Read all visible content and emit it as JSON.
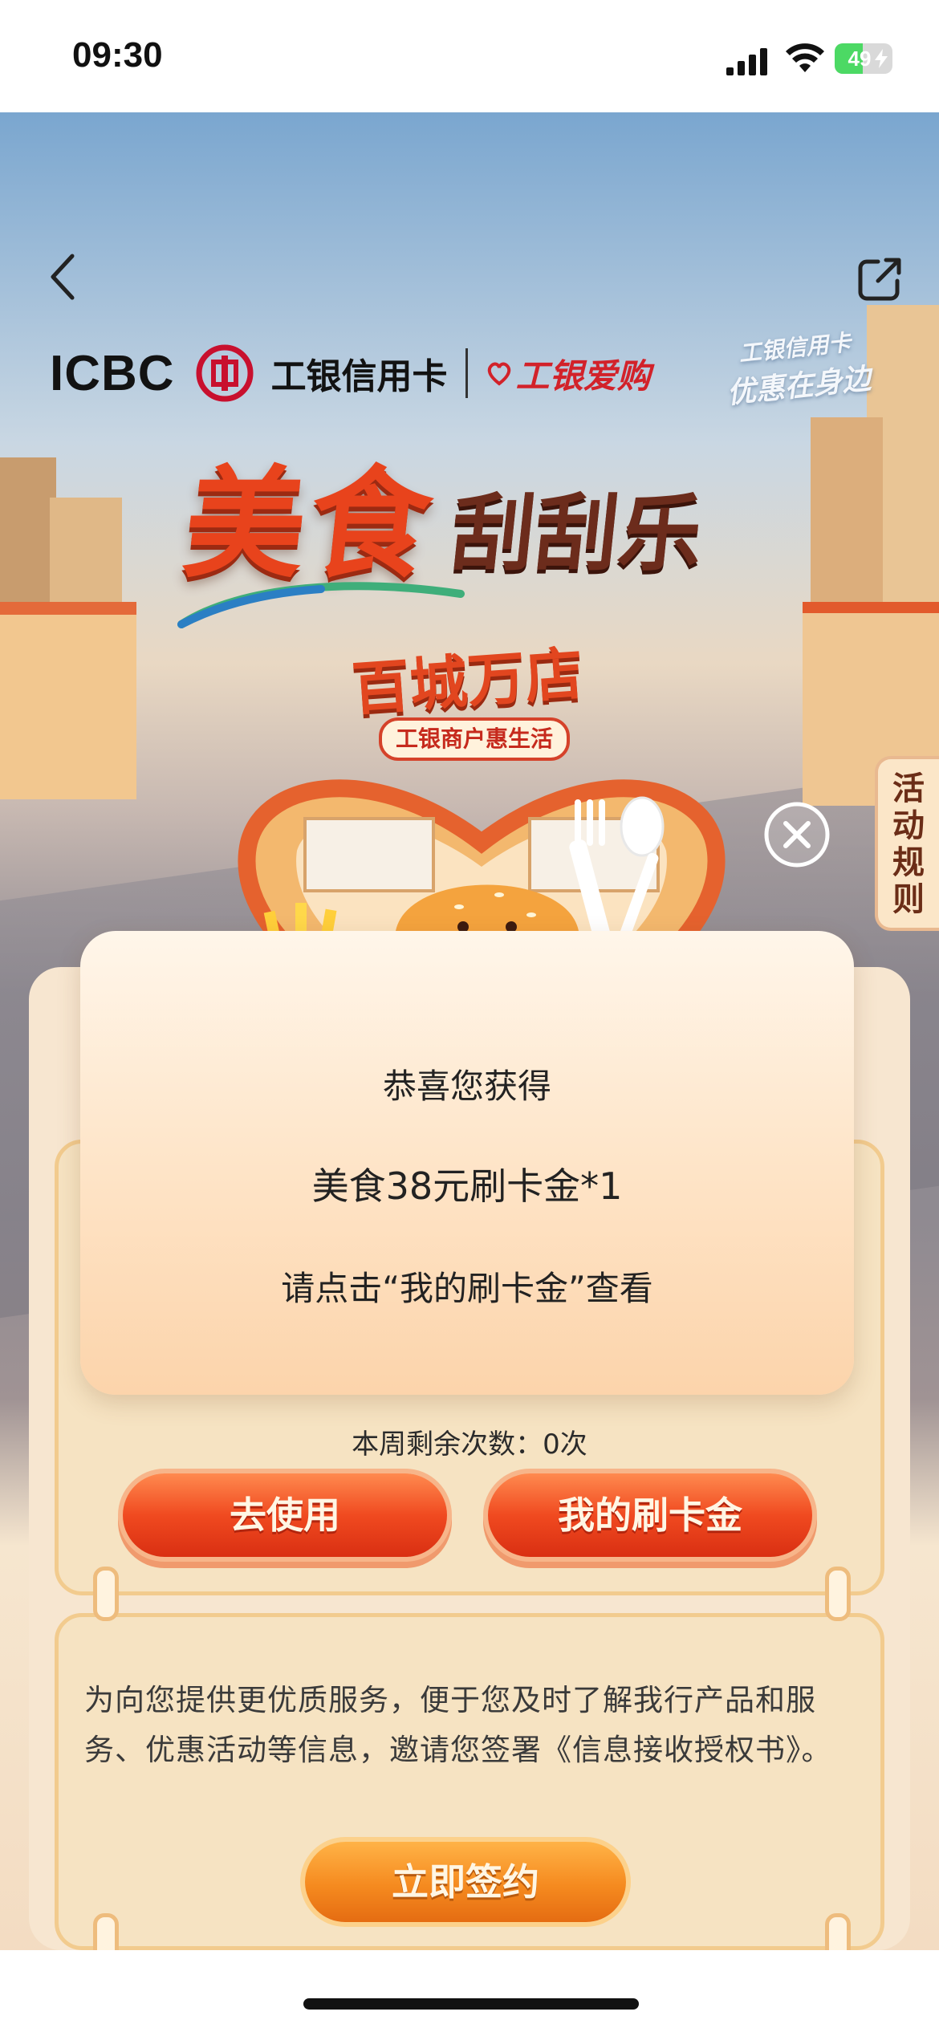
{
  "status_bar": {
    "time": "09:30",
    "battery": "49",
    "battery_level": 0.49
  },
  "header": {
    "brand": "ICBC",
    "card_name": "工银信用卡",
    "aigou": "工银爱购",
    "slogan_line1": "工银信用卡",
    "slogan_line2": "优惠在身边"
  },
  "hero": {
    "title_main": "美食",
    "title_sub": "刮刮乐",
    "badge": "百城万店",
    "badge_sub": "工银商户惠生活",
    "rules_label": "活动规则"
  },
  "popup": {
    "line1": "恭喜您获得",
    "line2": "美食38元刷卡金*1",
    "line3": "请点击“我的刷卡金”查看"
  },
  "actions": {
    "remain": "本周剩余次数：0次",
    "use_label": "去使用",
    "mine_label": "我的刷卡金"
  },
  "authorization": {
    "text": "为向您提供更优质服务，便于您及时了解我行产品和服务、优惠活动等信息，邀请您签署《信息接收授权书》。",
    "sign_label": "立即签约"
  },
  "colors": {
    "primary_red": "#e8431c",
    "popup_bg": "#fee3c5",
    "button_orange": "#f58a1f"
  }
}
